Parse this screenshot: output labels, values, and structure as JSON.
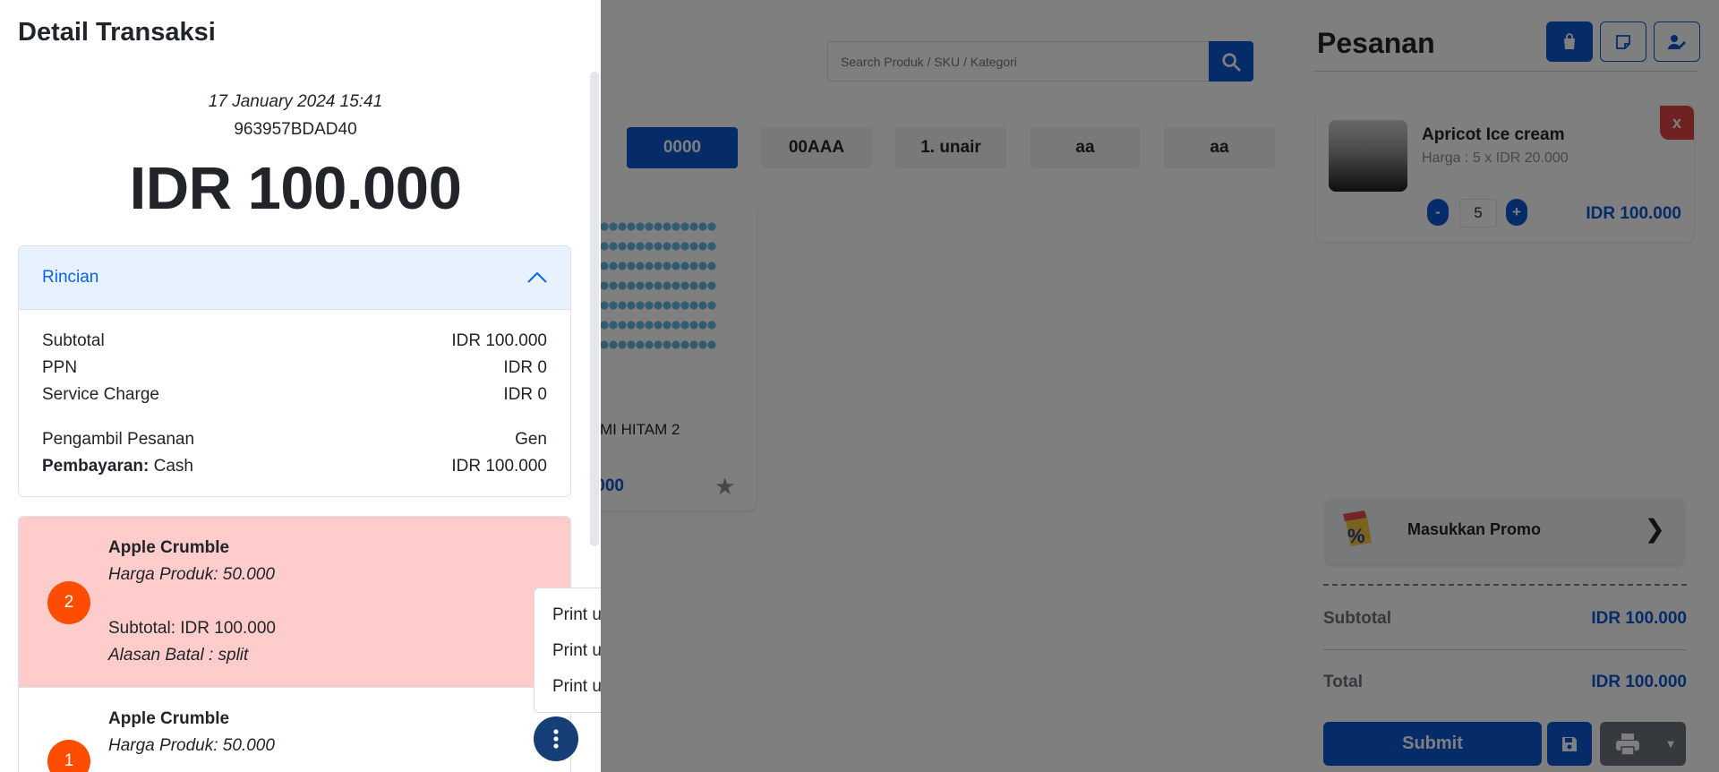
{
  "pos": {
    "search": {
      "placeholder": "Search Produk / SKU / Kategori"
    },
    "categories": [
      "0000",
      "00AAA",
      "1. unair",
      "aa",
      "aa"
    ],
    "product": {
      "name": "MI HITAM 2",
      "price": ".000"
    },
    "order": {
      "title": "Pesanan",
      "item": {
        "name": "Apricot Ice cream",
        "harga": "Harga : 5 x IDR 20.000",
        "remove": "x",
        "minus": "-",
        "plus": "+",
        "qty": "5",
        "total": "IDR 100.000"
      },
      "promo_label": "Masukkan Promo",
      "promo_chevron": "❯",
      "subtotal_label": "Subtotal",
      "subtotal_value": "IDR 100.000",
      "total_label": "Total",
      "total_value": "IDR 100.000",
      "submit_label": "Submit"
    }
  },
  "drawer": {
    "title": "Detail Transaksi",
    "date": "17 January 2024 15:41",
    "id": "963957BDAD40",
    "amount": "IDR 100.000",
    "rincian": {
      "title": "Rincian",
      "subtotal_label": "Subtotal",
      "subtotal_value": "IDR 100.000",
      "ppn_label": "PPN",
      "ppn_value": "IDR 0",
      "service_label": "Service Charge",
      "service_value": "IDR 0",
      "pengambil_label": "Pengambil Pesanan",
      "pengambil_value": "Gen",
      "pembayaran_label": "Pembayaran:",
      "pembayaran_method": "Cash",
      "pembayaran_value": "IDR 100.000"
    },
    "items": [
      {
        "badge": "2",
        "name": "Apple Crumble",
        "harga": "Harga Produk: 50.000",
        "subtotal": "Subtotal: IDR 100.000",
        "alasan": "Alasan Batal : split"
      },
      {
        "badge": "1",
        "name": "Apple Crumble",
        "harga": "Harga Produk: 50.000"
      }
    ],
    "menu": [
      "Print ulang nota",
      "Print ulang pesanan",
      "Print ulang cek"
    ]
  },
  "colors": {
    "primary": "#0a56d0",
    "cancelled_bg": "#ffcccc",
    "badge": "#ff4d00",
    "kebab": "#163f77"
  }
}
